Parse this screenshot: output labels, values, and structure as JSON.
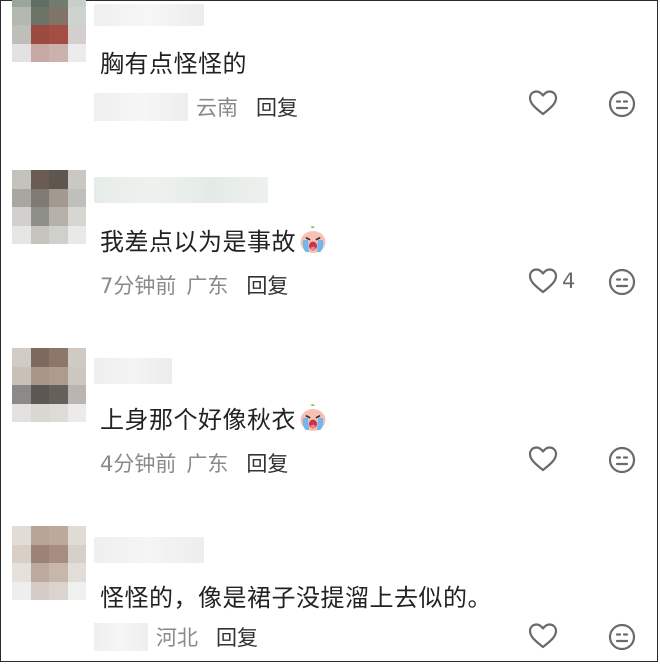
{
  "comments": [
    {
      "text": "胸有点怪怪的",
      "has_emoji": false,
      "time": "",
      "location": "云南",
      "reply_label": "回复",
      "likes": ""
    },
    {
      "text": "我差点以为是事故",
      "has_emoji": true,
      "emoji": "crying-face",
      "time": "7分钟前",
      "location": "广东",
      "reply_label": "回复",
      "likes": "4"
    },
    {
      "text": "上身那个好像秋衣",
      "has_emoji": true,
      "emoji": "crying-face",
      "time": "4分钟前",
      "location": "广东",
      "reply_label": "回复",
      "likes": ""
    },
    {
      "text": "怪怪的，像是裙子没提溜上去似的。",
      "has_emoji": false,
      "time": "",
      "location": "河北",
      "reply_label": "回复",
      "likes": ""
    }
  ],
  "icons": {
    "like": "heart-outline-icon",
    "dislike": "meh-face-icon"
  },
  "colors": {
    "text": "#222222",
    "meta": "#8a8a8a",
    "icon": "#6a6a6a"
  }
}
